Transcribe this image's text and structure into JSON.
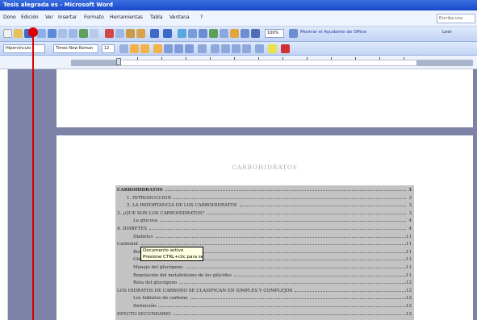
{
  "window": {
    "title": "Tesis alegrada es - Microsoft Word"
  },
  "menu": [
    {
      "label": "Dono"
    },
    {
      "label": "Edición"
    },
    {
      "label": "Ver"
    },
    {
      "label": "Insertar"
    },
    {
      "label": "Formato"
    },
    {
      "label": "Herramientas"
    },
    {
      "label": "Tabla"
    },
    {
      "label": "Ventana"
    },
    {
      "label": "?"
    }
  ],
  "help_box": {
    "placeholder": "Escriba una"
  },
  "toolbar_standard": {
    "zoom": "100%",
    "office_link": "Mostrar el Ayudante de Office",
    "read_button": "Leer"
  },
  "toolbar_format": {
    "style": "Hipervínculo",
    "font": "Times New Roman",
    "size": "12"
  },
  "document": {
    "title": "CARBOHIDRATOS",
    "tooltip": {
      "line1": "Documento activo",
      "line2": "Presione CTRL+clic para seguir vínculo"
    },
    "toc": [
      {
        "text": "CARBOHIDRATOS",
        "page": "3",
        "indent": 0,
        "head": true
      },
      {
        "text": "1.       INTRODUCCION",
        "page": "3",
        "indent": 12
      },
      {
        "text": "2.       LA IMPORTANCIA DE LOS CARBOHIDRATOS",
        "page": "3",
        "indent": 12
      },
      {
        "text": "3. ¿QUE SON LOS CARBOHIDRATOS?",
        "page": "3",
        "indent": 0
      },
      {
        "text": "La glucosa",
        "page": "4",
        "indent": 20
      },
      {
        "text": "4. DIABETES",
        "page": "4",
        "indent": 0
      },
      {
        "text": "Diabetes",
        "page": "11",
        "indent": 20
      },
      {
        "text": "Carbohid",
        "page": "11",
        "indent": 0
      },
      {
        "text": "Bioquím",
        "page": "11",
        "indent": 20
      },
      {
        "text": "Glucosa dentro de la célula",
        "page": "11",
        "indent": 20
      },
      {
        "text": "Manejo del glucógeno",
        "page": "11",
        "indent": 20
      },
      {
        "text": "Regulación del metabolismo de los glúcidos",
        "page": "11",
        "indent": 20
      },
      {
        "text": "Ruta del glucógeno",
        "page": "12",
        "indent": 20
      },
      {
        "text": "LOS HIDRATOS DE CARBONO SE CLASIFICAN EN SIMPLES Y COMPLEJOS",
        "page": "12",
        "indent": 0
      },
      {
        "text": "Los hidratos de carbono",
        "page": "12",
        "indent": 20
      },
      {
        "text": "Definición",
        "page": "12",
        "indent": 20
      },
      {
        "text": "EFECTO SECUNDARIO",
        "page": "12",
        "indent": 0
      }
    ]
  }
}
